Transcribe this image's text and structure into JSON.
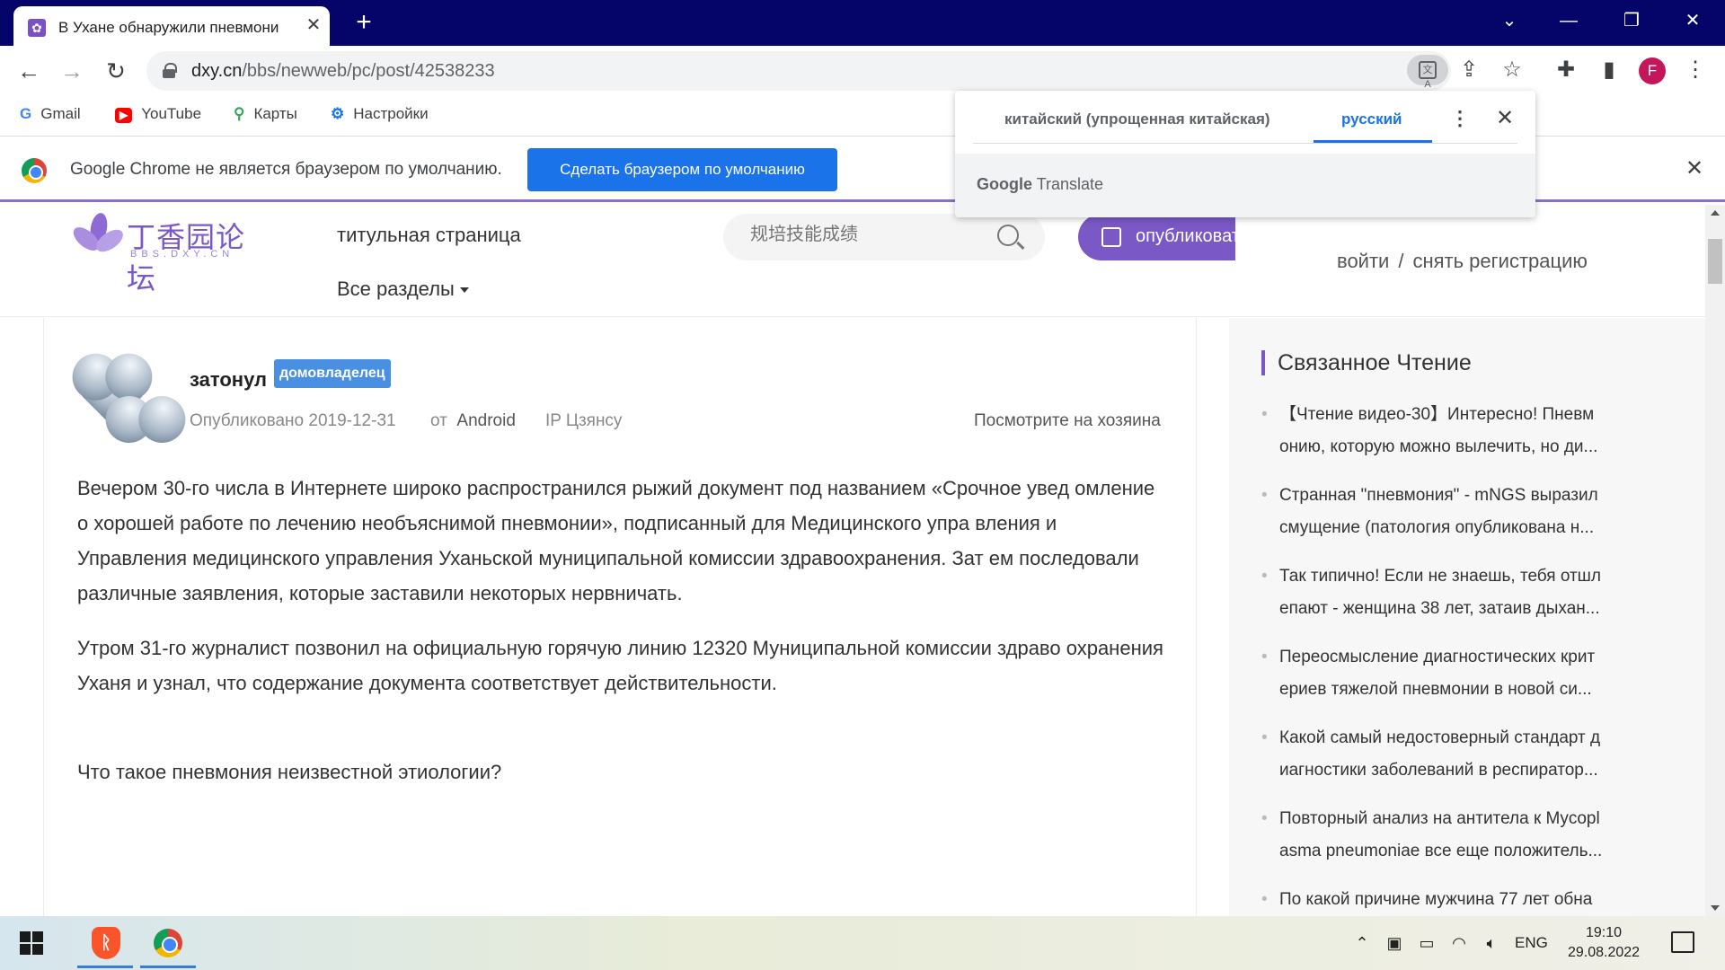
{
  "browser": {
    "tab_title": "В Ухане обнаружили пневмони",
    "tab_favicon": "dxy-favicon",
    "url_domain": "dxy.cn",
    "url_path": "/bbs/newweb/pc/post/42538233",
    "profile_initial": "F"
  },
  "bookmarks": [
    {
      "label": "Gmail",
      "icon": "G"
    },
    {
      "label": "YouTube",
      "icon": "▶"
    },
    {
      "label": "Карты",
      "icon": "⚲"
    },
    {
      "label": "Настройки",
      "icon": "⚙"
    }
  ],
  "infobar": {
    "message": "Google Chrome не является браузером по умолчанию.",
    "button_label": "Сделать браузером по умолчанию"
  },
  "translate": {
    "source_lang": "китайский (упрощенная китайская)",
    "target_lang": "русский",
    "brand_google": "Google",
    "brand_translate": "Translate"
  },
  "site": {
    "logo_cn": "丁香园论坛",
    "logo_sub": "BBS.DXY.CN",
    "nav_home": "титульная страница",
    "nav_all": "Все разделы",
    "search_placeholder": "规培技能成绩",
    "publish_label": "опубликовать",
    "login": "войти",
    "separator": "/",
    "register": "снять регистрацию"
  },
  "post": {
    "author": "затонул",
    "role": "домовладелец",
    "published": "Опубликовано 2019-12-31",
    "from_label": "от",
    "device": "Android",
    "ip": "IP Цзянсу",
    "owner_link": "Посмотрите на хозяина",
    "paragraphs": [
      "Вечером 30-го числа в Интернете широко распространился рыжий документ под названием «Срочное увед омление о хорошей работе по лечению необъяснимой пневмонии», подписанный для Медицинского упра вления и Управления медицинского управления Уханьской муниципальной комиссии здравоохранения. Зат ем последовали различные заявления, которые заставили некоторых нервничать.",
      "Утром 31-го журналист позвонил на официальную горячую линию 12320 Муниципальной комиссии здраво охранения Уханя и узнал, что содержание документа соответствует действительности.",
      "Что такое пневмония неизвестной этиологии?"
    ]
  },
  "sidebar": {
    "title": "Связанное Чтение",
    "items": [
      {
        "line1": "【Чтение видео-30】Интересно! Пневм",
        "line2": "онию, которую можно вылечить, но ди..."
      },
      {
        "line1": "Странная \"пневмония\" - mNGS выразил",
        "line2": "смущение (патология опубликована н..."
      },
      {
        "line1": "Так типично! Если не знаешь, тебя отшл",
        "line2": "епают - женщина 38 лет, затаив дыхан..."
      },
      {
        "line1": "Переосмысление диагностических крит",
        "line2": "ериев тяжелой пневмонии в новой си..."
      },
      {
        "line1": "Какой самый недостоверный стандарт д",
        "line2": "иагностики заболеваний в респиратор..."
      },
      {
        "line1": "Повторный анализ на антитела к Mycopl",
        "line2": "asma pneumoniae все еще положитель..."
      },
      {
        "line1": "По какой причине мужчина 77 лет обна",
        "line2": ""
      }
    ]
  },
  "taskbar": {
    "lang": "ENG",
    "time": "19:10",
    "date": "29.08.2022"
  }
}
